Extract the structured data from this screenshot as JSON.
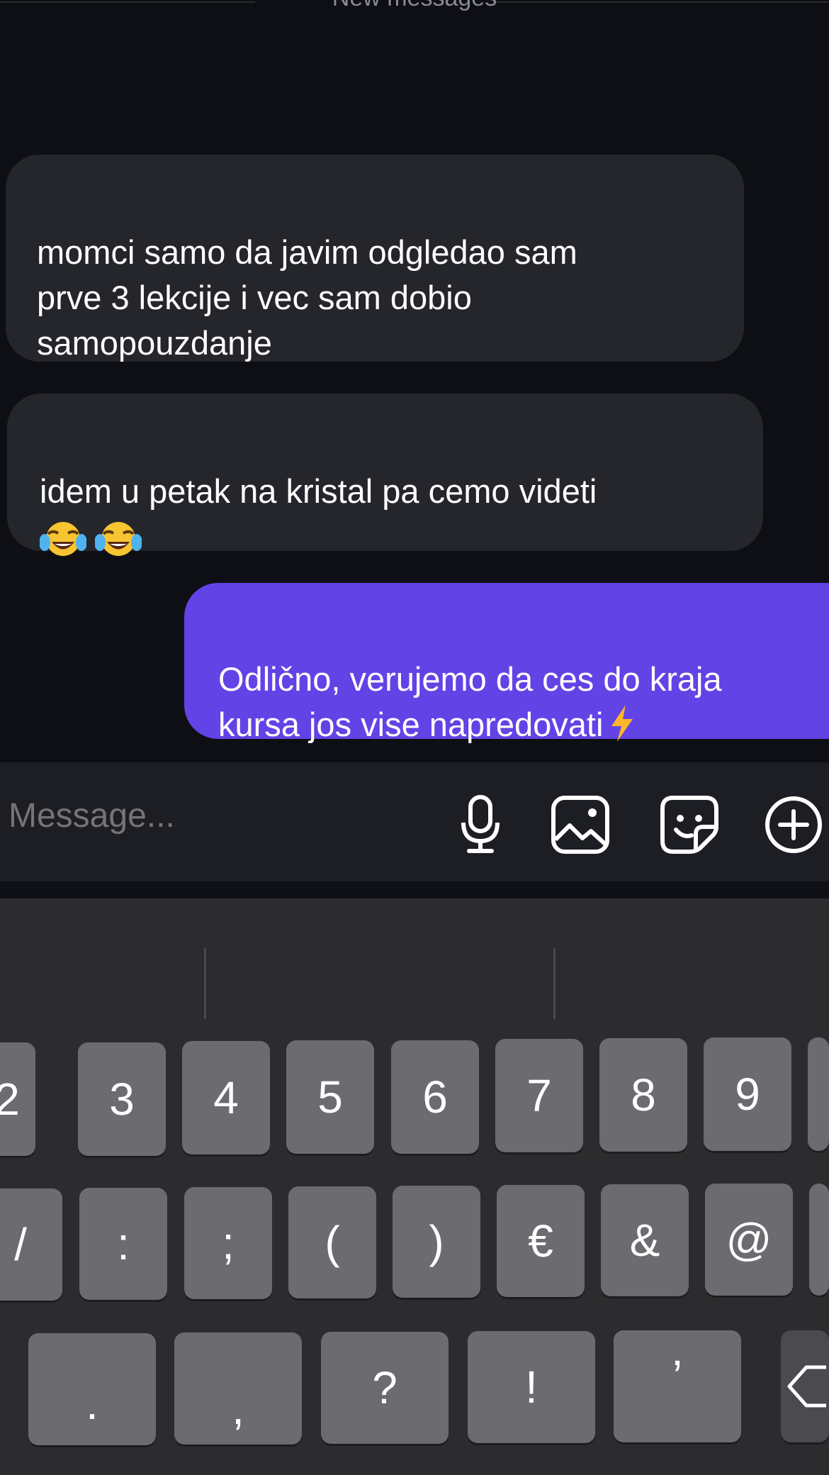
{
  "chat": {
    "separator_label": "New messages",
    "messages": [
      {
        "direction": "incoming",
        "text": "momci samo da javim odgledao sam\nprve 3 lekcije i vec sam dobio\nsamopouzdanje"
      },
      {
        "direction": "incoming",
        "text": "idem u petak na kristal pa cemo videti",
        "emoji": [
          "face-with-tears-of-joy",
          "face-with-tears-of-joy"
        ]
      },
      {
        "direction": "outgoing",
        "text": "Odlično, verujemo da ces do kraja\nkursa jos vise napredovati",
        "emoji": [
          "high-voltage"
        ]
      }
    ]
  },
  "composer": {
    "placeholder": "Message...",
    "icons": [
      "microphone-icon",
      "image-icon",
      "sticker-icon",
      "plus-circle-icon"
    ]
  },
  "keyboard": {
    "row1": [
      "2",
      "3",
      "4",
      "5",
      "6",
      "7",
      "8",
      "9",
      ""
    ],
    "row2": [
      "/",
      ":",
      ";",
      "(",
      ")",
      "€",
      "&",
      "@",
      ""
    ],
    "row3": [
      ".",
      ",",
      "?",
      "!",
      "’",
      ""
    ]
  },
  "colors": {
    "background": "#0e0f14",
    "incoming_bubble": "#25262b",
    "outgoing_bubble": "#6243e6",
    "key": "#6b6b70"
  }
}
